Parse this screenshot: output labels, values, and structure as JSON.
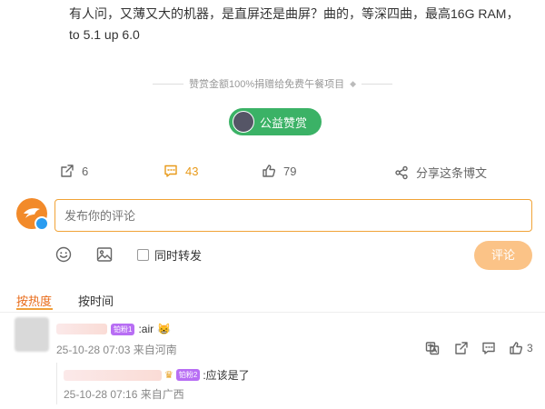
{
  "post": {
    "text_line1": "有人问，又薄又大的机器，是直屏还是曲屏？曲的，等深四曲，最高16G RAM，",
    "text_line2": "to 5.1 up 6.0"
  },
  "reward": {
    "note": "赞赏金额100%捐赠给免费午餐项目",
    "button_label": "公益赞赏",
    "button_color": "#3bb266"
  },
  "stats": {
    "reposts": "6",
    "comments": "43",
    "likes": "79",
    "share_label": "分享这条博文"
  },
  "composer": {
    "placeholder": "发布你的评论",
    "repost_label": "同时转发",
    "submit_label": "评论",
    "accent_color": "#f1a337"
  },
  "sort_tabs": {
    "hot": "按热度",
    "time": "按时间"
  },
  "comments": [
    {
      "badge": "铂粉1",
      "text": ":air",
      "emoji": "😸",
      "time": "25-10-28 07:03",
      "location": "来自河南",
      "likes": "3",
      "replies": [
        {
          "badge": "铂粉2",
          "text": ":应该是了",
          "time": "25-10-28 07:16",
          "location": "来自广西"
        }
      ]
    }
  ]
}
